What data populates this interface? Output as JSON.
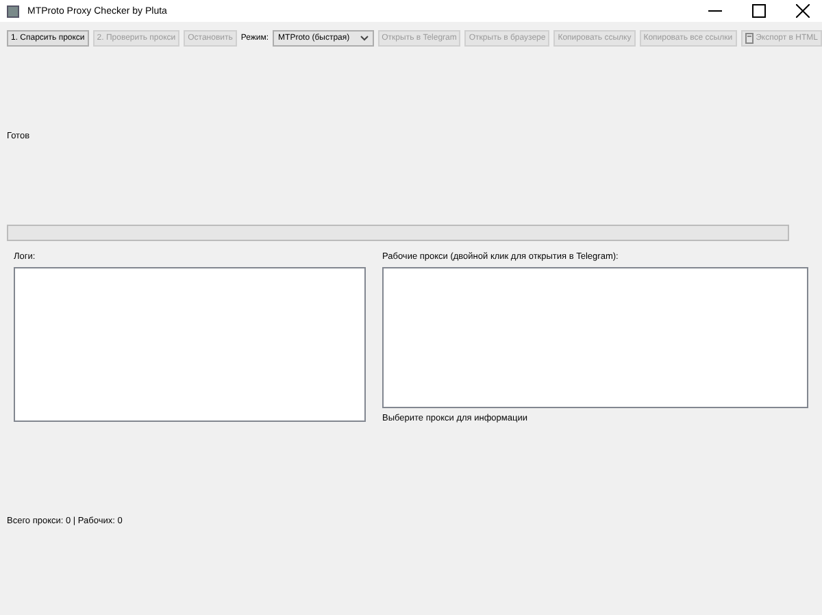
{
  "window": {
    "title": "MTProto Proxy Checker by Pluta"
  },
  "toolbar": [
    {
      "kind": "button",
      "label": "1. Спарсить прокси",
      "disabled": false
    },
    {
      "kind": "button",
      "label": "2. Проверить прокси",
      "disabled": true
    },
    {
      "kind": "button",
      "label": "Остановить",
      "disabled": true
    },
    {
      "kind": "select",
      "label": "Режим:",
      "value": "MTProto (быстрая)"
    },
    {
      "kind": "button",
      "label": "Открыть в Telegram",
      "disabled": true
    },
    {
      "kind": "button",
      "label": "Открыть в браузере",
      "disabled": true
    },
    {
      "kind": "button",
      "label": "Копировать ссылку",
      "disabled": true
    },
    {
      "kind": "button",
      "label": "Копировать все ссылки",
      "disabled": true
    },
    {
      "kind": "icon-button",
      "label": "Экспорт в HTML",
      "disabled": true
    }
  ],
  "status": "Готов",
  "progress": {
    "level": 0
  },
  "logs": {
    "label": "Логи:"
  },
  "working": {
    "label": "Рабочие прокси (двойной клик для открытия в Telegram):",
    "hint": "Выберите прокси для информации"
  },
  "summary": "Всего прокси: 0 | Рабочих: 0"
}
